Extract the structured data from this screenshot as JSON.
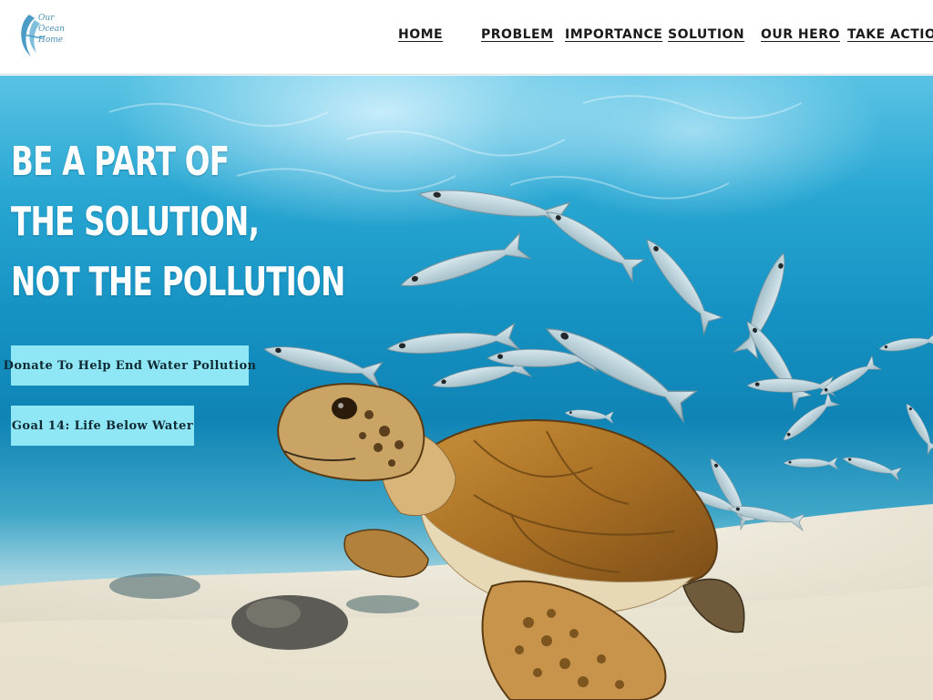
{
  "logo": {
    "lines": "Our\nOcean\nHome",
    "color": "#4a8fb4"
  },
  "nav": {
    "home": "HOME",
    "problem": "PROBLEM",
    "importance": "IMPORTANCE",
    "solution": "SOLUTION",
    "our_hero": "OUR HERO",
    "take_action": "TAKE ACTION"
  },
  "hero": {
    "headline": {
      "line1": "BE A PART OF",
      "line2": "THE SOLUTION,",
      "line3": "NOT THE POLLUTION"
    },
    "buttons": {
      "donate": "Donate To Help End Water Pollution",
      "goal": "Goal 14: Life Below Water"
    },
    "image": "sea-turtle-and-school-of-fish-underwater"
  },
  "colors": {
    "button_bg": "#8fe6f5",
    "headline": "#ffffff",
    "water": "#1592c3",
    "sand": "#f1ede2"
  }
}
